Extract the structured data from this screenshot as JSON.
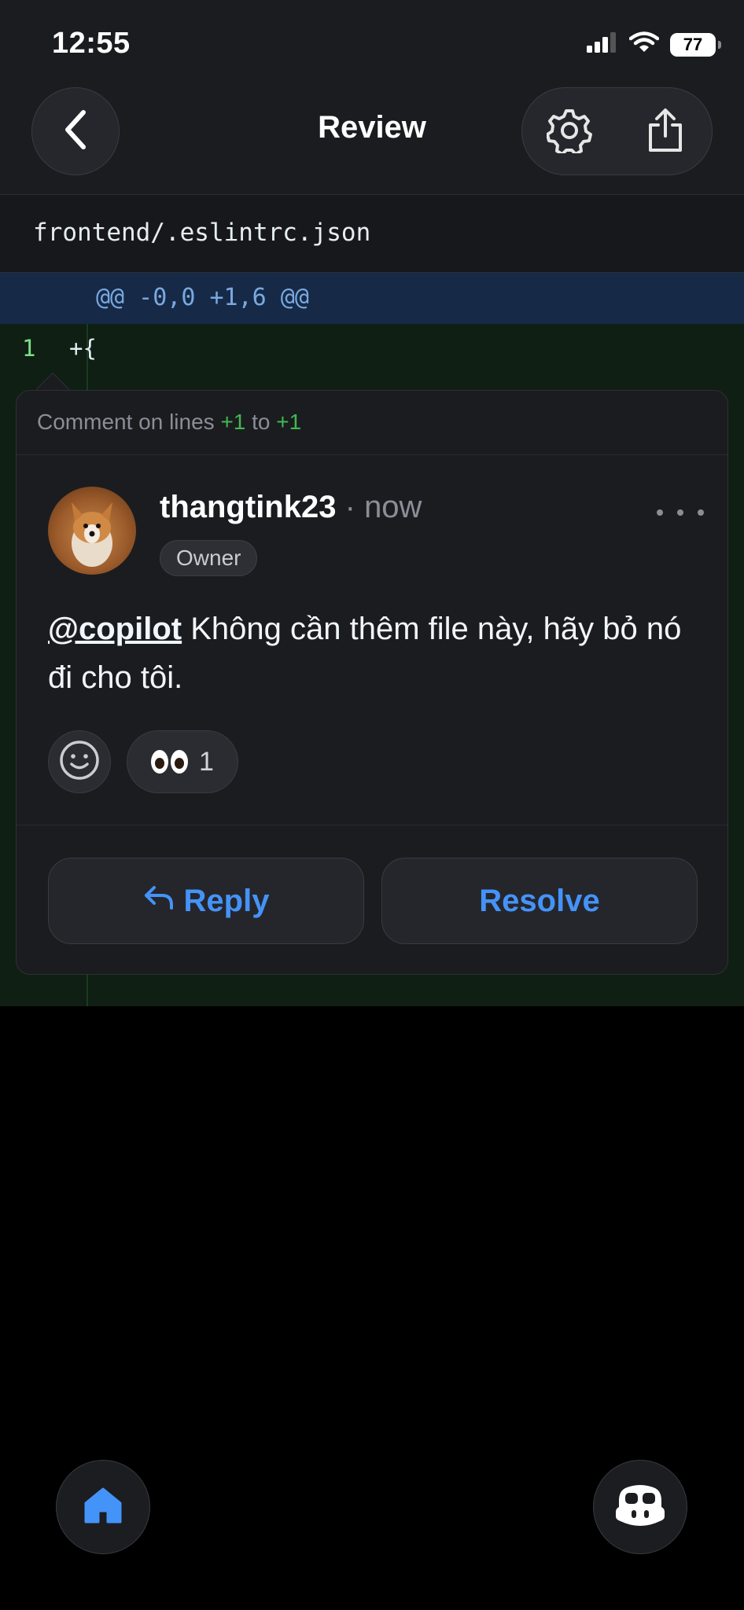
{
  "status_bar": {
    "time": "12:55",
    "battery": "77"
  },
  "header": {
    "title": "Review"
  },
  "file": {
    "path": "frontend/.eslintrc.json"
  },
  "diff": {
    "hunk": "@@ -0,0 +1,6 @@",
    "lines": [
      {
        "number": "1",
        "code": "+{"
      }
    ]
  },
  "comment": {
    "context_prefix": "Comment on lines",
    "from_line": "+1",
    "to_word": "to",
    "to_line": "+1",
    "author": "thangtink23",
    "time_sep": "·",
    "time": "now",
    "role_badge": "Owner",
    "mention": "@copilot",
    "body": " Không cần thêm file này, hãy bỏ nó đi cho tôi.",
    "reactions": [
      {
        "emoji": "eyes-emoji",
        "count": "1"
      }
    ],
    "reply_label": "Reply",
    "resolve_label": "Resolve"
  },
  "colors": {
    "accent": "#4493f8",
    "added_green": "#3fb950",
    "diff_bg": "#0f1f13",
    "hunk_bg": "#162a47"
  },
  "icons": [
    "back-chevron-icon",
    "gear-icon",
    "share-icon",
    "more-dots-icon",
    "smiley-add-icon",
    "reply-arrow-icon",
    "home-icon",
    "copilot-icon",
    "signal-icon",
    "wifi-icon",
    "battery-icon"
  ]
}
